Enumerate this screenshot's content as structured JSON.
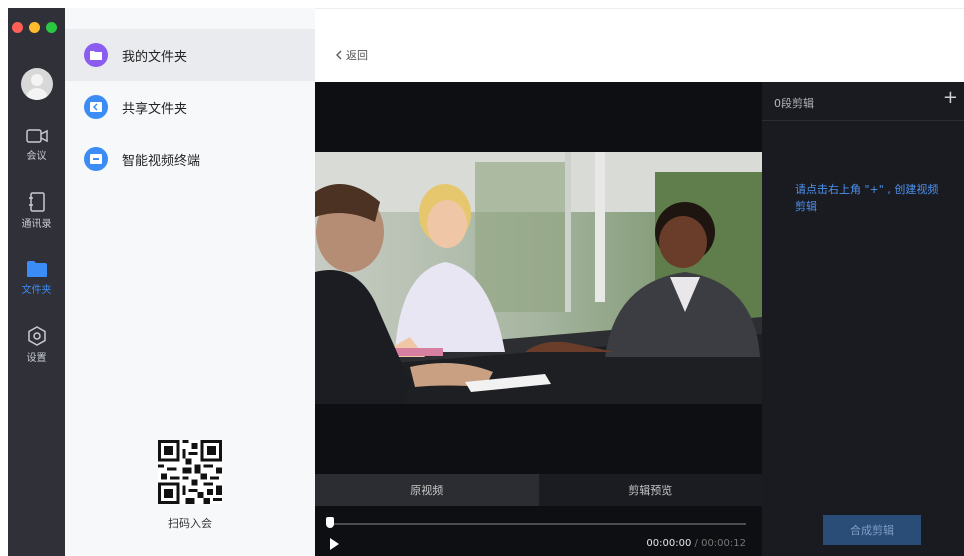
{
  "window": {
    "traffic_colors": [
      "#fe5f57",
      "#febc2e",
      "#28c840"
    ]
  },
  "rail": {
    "items": [
      {
        "label": "会议",
        "icon": "video-camera-icon"
      },
      {
        "label": "通讯录",
        "icon": "contacts-icon"
      },
      {
        "label": "文件夹",
        "icon": "folder-icon",
        "active": true
      },
      {
        "label": "设置",
        "icon": "settings-icon"
      }
    ]
  },
  "folders": {
    "items": [
      {
        "label": "我的文件夹",
        "icon": "my-folder-icon",
        "color": "#8a5cf0"
      },
      {
        "label": "共享文件夹",
        "icon": "share-folder-icon",
        "color": "#3b8cf5"
      },
      {
        "label": "智能视频终端",
        "icon": "video-terminal-icon",
        "color": "#3b8cf5"
      }
    ],
    "qr_label": "扫码入会"
  },
  "header": {
    "back_label": "返回"
  },
  "player": {
    "tabs": [
      "原视频",
      "剪辑预览"
    ],
    "current_time": "00:00:00",
    "total_time": "00:00:12",
    "progress": 0
  },
  "clips": {
    "count_label": "0段剪辑",
    "add_label": "+",
    "hint": "请点击右上角 \"+\" , 创建视频剪辑",
    "merge_label": "合成剪辑"
  }
}
